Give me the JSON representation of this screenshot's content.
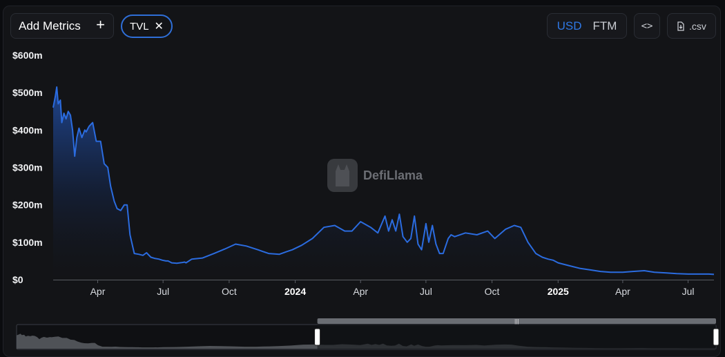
{
  "toolbar": {
    "add_metrics_label": "Add Metrics",
    "add_icon": "plus-icon",
    "metric_pill_label": "TVL",
    "remove_icon": "close-icon",
    "currency_options": [
      "USD",
      "FTM"
    ],
    "currency_selected": "USD",
    "embed_icon": "code-icon",
    "download_icon": "download-icon",
    "csv_label": ".csv"
  },
  "watermark": {
    "text": "DefiLlama",
    "icon": "llama-logo-icon"
  },
  "colors": {
    "accent": "#2f79e6",
    "line": "#2b6ce0",
    "background": "#131417"
  },
  "chart_data": {
    "type": "area",
    "series": [
      {
        "name": "TVL",
        "x": [
          "2023-01-29",
          "2023-02-01",
          "2023-02-03",
          "2023-02-05",
          "2023-02-08",
          "2023-02-10",
          "2023-02-13",
          "2023-02-16",
          "2023-02-19",
          "2023-02-22",
          "2023-02-25",
          "2023-02-28",
          "2023-03-03",
          "2023-03-06",
          "2023-03-10",
          "2023-03-14",
          "2023-03-16",
          "2023-03-20",
          "2023-03-25",
          "2023-03-30",
          "2023-04-05",
          "2023-04-10",
          "2023-04-15",
          "2023-04-19",
          "2023-04-24",
          "2023-04-28",
          "2023-05-03",
          "2023-05-08",
          "2023-05-12",
          "2023-05-16",
          "2023-05-22",
          "2023-05-28",
          "2023-06-03",
          "2023-06-08",
          "2023-06-14",
          "2023-06-19",
          "2023-06-25",
          "2023-06-30",
          "2023-07-05",
          "2023-07-08",
          "2023-07-10",
          "2023-07-11",
          "2023-07-13",
          "2023-07-20",
          "2023-07-28",
          "2023-07-31",
          "2023-08-02",
          "2023-08-10",
          "2023-08-25",
          "2023-09-10",
          "2023-09-25",
          "2023-10-10",
          "2023-10-25",
          "2023-11-10",
          "2023-11-25",
          "2023-12-10",
          "2023-12-20",
          "2023-12-28",
          "2024-01-10",
          "2024-01-25",
          "2024-02-10",
          "2024-02-25",
          "2024-03-10",
          "2024-03-20",
          "2024-04-01",
          "2024-04-15",
          "2024-04-25",
          "2024-05-05",
          "2024-05-10",
          "2024-05-15",
          "2024-05-20",
          "2024-05-25",
          "2024-05-30",
          "2024-06-05",
          "2024-06-10",
          "2024-06-15",
          "2024-06-20",
          "2024-06-25",
          "2024-07-01",
          "2024-07-05",
          "2024-07-10",
          "2024-07-15",
          "2024-07-20",
          "2024-07-25",
          "2024-08-01",
          "2024-08-05",
          "2024-08-10",
          "2024-08-25",
          "2024-09-10",
          "2024-09-25",
          "2024-10-05",
          "2024-10-20",
          "2024-11-01",
          "2024-11-10",
          "2024-11-20",
          "2024-12-01",
          "2024-12-10",
          "2024-12-18",
          "2024-12-25",
          "2025-01-01",
          "2025-01-15",
          "2025-02-01",
          "2025-02-15",
          "2025-03-01",
          "2025-03-15",
          "2025-04-01",
          "2025-04-15",
          "2025-05-01",
          "2025-05-15",
          "2025-06-01",
          "2025-06-15",
          "2025-07-01",
          "2025-07-15",
          "2025-07-30",
          "2025-08-06"
        ],
        "values": [
          460,
          490,
          515,
          470,
          480,
          420,
          445,
          430,
          450,
          440,
          400,
          330,
          380,
          405,
          380,
          400,
          395,
          410,
          420,
          370,
          370,
          310,
          300,
          250,
          210,
          190,
          185,
          200,
          200,
          120,
          70,
          68,
          65,
          72,
          60,
          57,
          55,
          52,
          50,
          50,
          48,
          47,
          45,
          44,
          46,
          47,
          45,
          55,
          58,
          70,
          82,
          95,
          90,
          80,
          70,
          68,
          75,
          80,
          92,
          110,
          140,
          145,
          130,
          130,
          155,
          140,
          125,
          170,
          130,
          160,
          130,
          175,
          115,
          100,
          110,
          170,
          95,
          80,
          150,
          100,
          145,
          95,
          70,
          70,
          110,
          120,
          115,
          125,
          120,
          130,
          110,
          135,
          145,
          140,
          100,
          70,
          60,
          55,
          52,
          45,
          38,
          30,
          26,
          22,
          20,
          20,
          22,
          24,
          20,
          18,
          16,
          15,
          15,
          15,
          14
        ]
      }
    ],
    "title": "",
    "xlabel": "",
    "ylabel": "",
    "x_ticks": [
      "Apr",
      "Jul",
      "Oct",
      "2024",
      "Apr",
      "Jul",
      "Oct",
      "2025",
      "Apr",
      "Jul"
    ],
    "x_tick_dates": [
      "2023-04-01",
      "2023-07-01",
      "2023-10-01",
      "2024-01-01",
      "2024-04-01",
      "2024-07-01",
      "2024-10-01",
      "2025-01-01",
      "2025-04-01",
      "2025-07-01"
    ],
    "x_tick_bold": [
      false,
      false,
      false,
      true,
      false,
      false,
      false,
      true,
      false,
      false
    ],
    "y_ticks": [
      "$0",
      "$100m",
      "$200m",
      "$300m",
      "$400m",
      "$500m",
      "$600m"
    ],
    "y_tick_values": [
      0,
      100,
      200,
      300,
      400,
      500,
      600
    ],
    "ylim": [
      0,
      600
    ],
    "xlim": [
      "2023-01-29",
      "2025-08-06"
    ],
    "unit": "USD millions",
    "grid": false,
    "legend": "none",
    "range_selector": {
      "selected_start_fraction": 0.0,
      "selected_end_fraction": 0.43
    }
  }
}
